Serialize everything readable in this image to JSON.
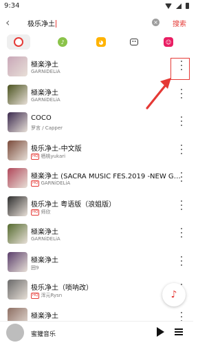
{
  "status": {
    "time": "9:34"
  },
  "search": {
    "query": "极乐净土",
    "button": "搜索",
    "back_icon": "back-arrow-icon",
    "clear_icon": "clear-icon"
  },
  "sources": [
    {
      "name": "netease-icon",
      "color": "#e53935",
      "active": true
    },
    {
      "name": "qq-music-icon",
      "color": "#f5c518"
    },
    {
      "name": "kuwo-icon",
      "color": "#ffb300"
    },
    {
      "name": "bilibili-icon",
      "color": "#333333"
    },
    {
      "name": "migu-icon",
      "color": "#e91e63"
    }
  ],
  "songs": [
    {
      "title": "極楽浄土",
      "artist": "GARNiDELiA",
      "hq": false,
      "thumb": "#c9a7b8"
    },
    {
      "title": "極楽浄土",
      "artist": "GARNiDELiA",
      "hq": false,
      "thumb": "#4b5320"
    },
    {
      "title": "COCO",
      "artist": "罗言 / Capper",
      "hq": false,
      "thumb": "#3b2a4e"
    },
    {
      "title": "极乐净土-中文版",
      "artist": "栖桃yukari",
      "hq": true,
      "thumb": "#7a4a3a"
    },
    {
      "title": "極楽浄土 (SACRA MUSIC FES.2019 -NEW GE...",
      "artist": "GARNiDELiA",
      "hq": true,
      "thumb": "#b0475a"
    },
    {
      "title": "极乐净土 粤语版（浪姐版）",
      "artist": "师欣",
      "hq": true,
      "thumb": "#2f2f2f"
    },
    {
      "title": "極楽浄土",
      "artist": "GARNiDELiA",
      "hq": false,
      "thumb": "#556b2f"
    },
    {
      "title": "極楽浄土",
      "artist": "囲9",
      "hq": false,
      "thumb": "#5a3e6b"
    },
    {
      "title": "极乐净土（唢呐改）",
      "artist": "浑元Rysn",
      "hq": true,
      "thumb": "#6a6a6a"
    },
    {
      "title": "極楽浄土",
      "artist": "",
      "hq": false,
      "thumb": "#8d6e63"
    }
  ],
  "player": {
    "title": "蜜獾音乐"
  },
  "colors": {
    "accent": "#e53935"
  }
}
